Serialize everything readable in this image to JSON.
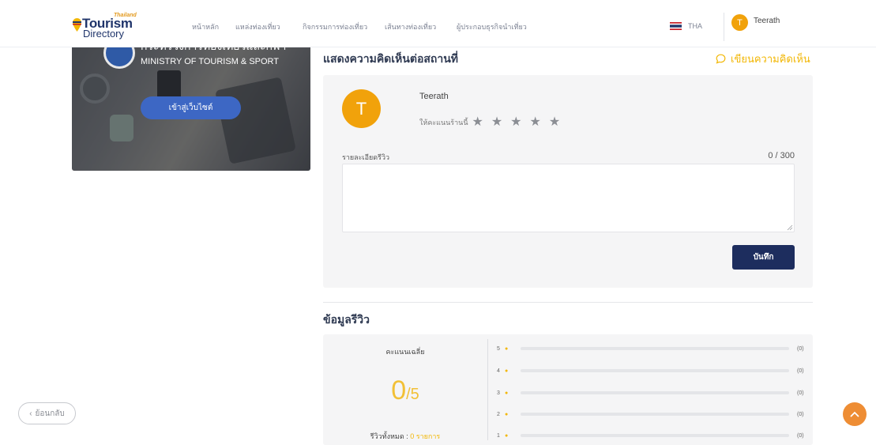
{
  "brand": {
    "thailand": "Thailand",
    "tourism": "Tourism",
    "directory": "Directory"
  },
  "nav": {
    "items": [
      {
        "label": "หน้าหลัก"
      },
      {
        "label": "แหล่งท่องเที่ยว"
      },
      {
        "label": "กิจกรรมการท่องเที่ยว"
      },
      {
        "label": "เส้นทางท่องเที่ยว"
      },
      {
        "label": "ผู้ประกอบธุรกิจนำเที่ยว"
      }
    ]
  },
  "header": {
    "lang": "THA",
    "user_initial": "T",
    "user_name": "Teerath"
  },
  "banner": {
    "ministry_th": "กระทรวงการท่องเที่ยวและกีฬา",
    "ministry_en": "MINISTRY OF TOURISM & SPORT",
    "enter_label": "เข้าสู่เว็บไซต์"
  },
  "review": {
    "title": "แสดงความคิดเห็นต่อสถานที่",
    "write_label": "เขียนความคิดเห็น",
    "avatar_initial": "T",
    "name": "Teerath",
    "rate_label": "ให้คะแนนร้านนี้",
    "detail_label": "รายละเอียดรีวิว",
    "counter": "0 / 300",
    "text_value": "",
    "save_label": "บันทึก"
  },
  "stats": {
    "title": "ข้อมูลรีวิว",
    "avg_label": "คะแนนเฉลี่ย",
    "avg_value": "0",
    "avg_max": "/5",
    "total_label": "รีวิวทั้งหมด :",
    "total_value": "0 รายการ",
    "rows": [
      {
        "star": "5",
        "count": "(0)",
        "fraction": 0
      },
      {
        "star": "4",
        "count": "(0)",
        "fraction": 0
      },
      {
        "star": "3",
        "count": "(0)",
        "fraction": 0
      },
      {
        "star": "2",
        "count": "(0)",
        "fraction": 0
      },
      {
        "star": "1",
        "count": "(0)",
        "fraction": 0
      }
    ]
  },
  "footer": {
    "back_label": "ย้อนกลับ"
  },
  "colors": {
    "accent": "#f2b705",
    "navy": "#1d2d5e",
    "avatar": "#f1a20b",
    "scroll_top": "#ee8d34"
  },
  "icons": {
    "logo": "location-pin-icon",
    "write": "speech-bubble-icon",
    "back": "chevron-left-icon",
    "top": "chevron-up-icon"
  }
}
